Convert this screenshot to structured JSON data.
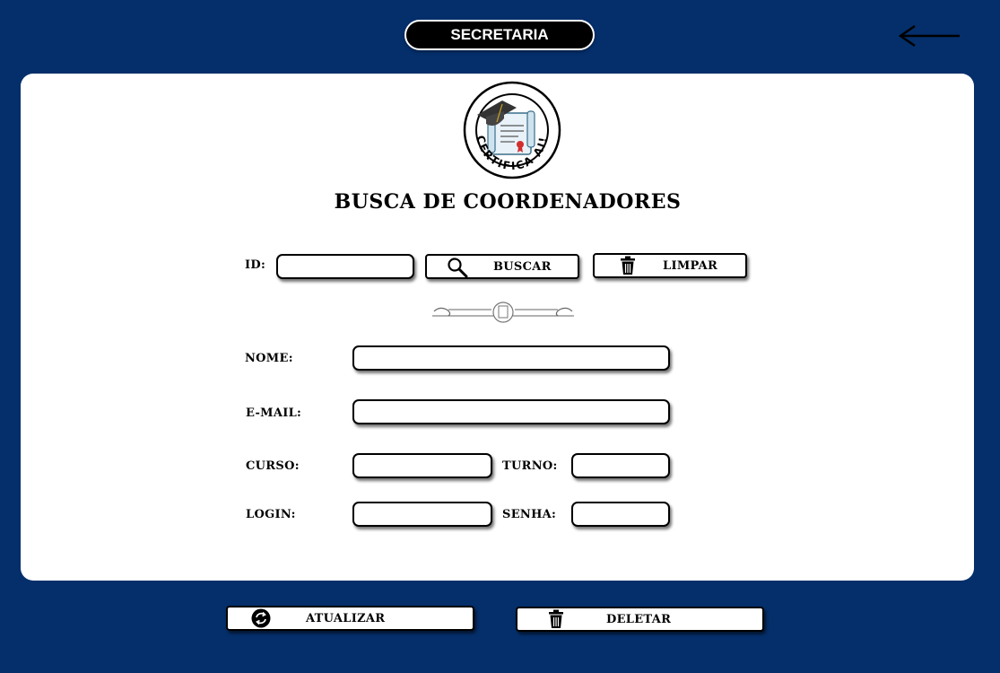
{
  "header": {
    "title": "SECRETARIA"
  },
  "nav": {
    "back_icon": "arrow-left-icon"
  },
  "logo": {
    "text": "CERTIFICA AI!",
    "icon": "certificate-scroll-logo"
  },
  "page": {
    "title": "BUSCA DE COORDENADORES"
  },
  "search": {
    "id_label": "ID:",
    "id_value": "",
    "search_button": "BUSCAR",
    "search_icon": "search-icon",
    "clear_button": "LIMPAR",
    "clear_icon": "trash-icon"
  },
  "form": {
    "nome_label": "NOME:",
    "nome_value": "",
    "email_label": "E-MAIL:",
    "email_value": "",
    "curso_label": "CURSO:",
    "curso_value": "",
    "turno_label": "TURNO:",
    "turno_value": "",
    "login_label": "LOGIN:",
    "login_value": "",
    "senha_label": "SENHA:",
    "senha_value": ""
  },
  "actions": {
    "update_button": "ATUALIZAR",
    "update_icon": "refresh-icon",
    "delete_button": "DELETAR",
    "delete_icon": "trash-icon"
  },
  "colors": {
    "background": "#052f6b",
    "card": "#ffffff",
    "accent": "#000000"
  }
}
